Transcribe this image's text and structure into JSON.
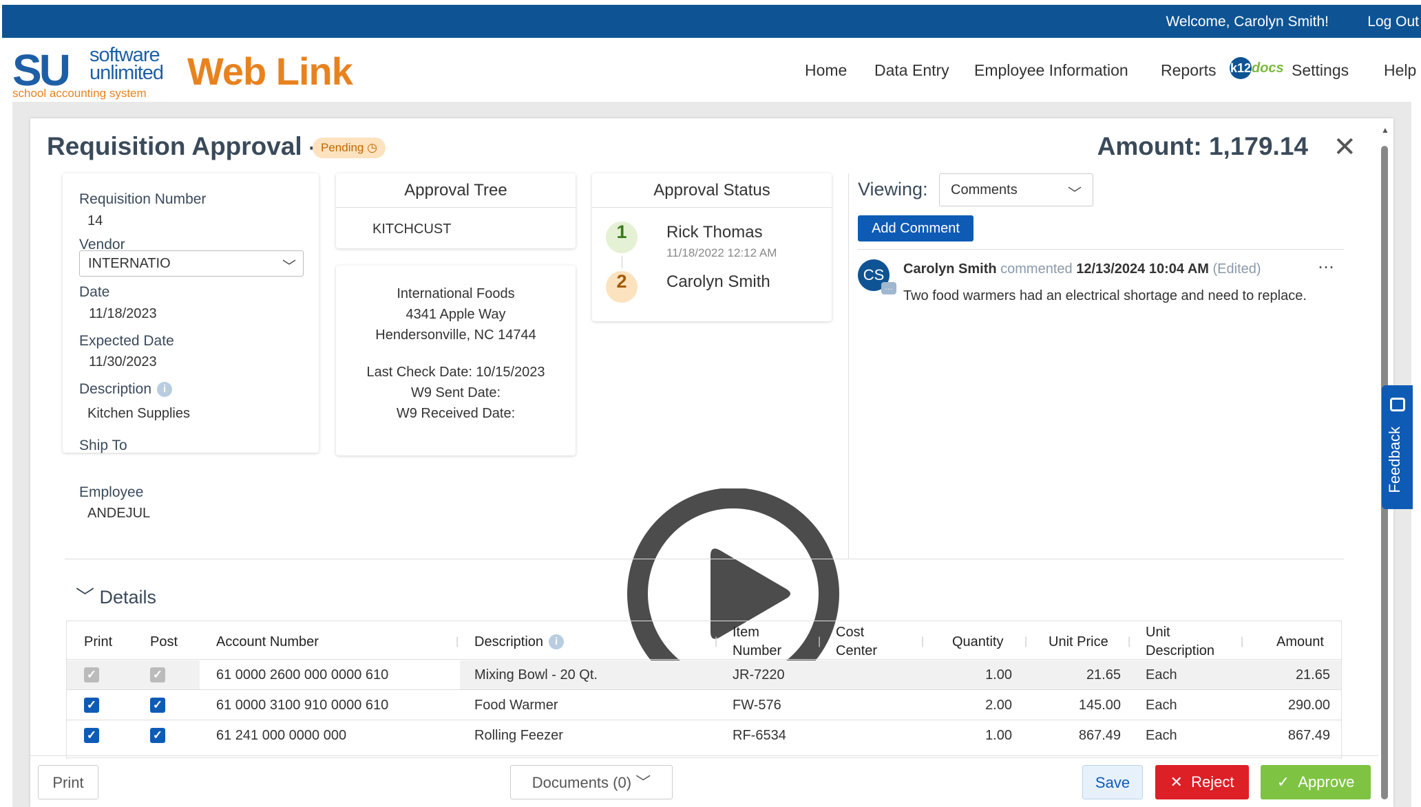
{
  "topbar": {
    "welcome": "Welcome, Carolyn Smith!",
    "logout": "Log Out"
  },
  "logo": {
    "su": "SU",
    "software": "software",
    "unlimited": "unlimited",
    "tagline": "school accounting system",
    "weblink": "Web Link"
  },
  "nav": {
    "home": "Home",
    "data_entry": "Data Entry",
    "employee": "Employee Information",
    "reports": "Reports",
    "k12": "k12",
    "docs": "docs",
    "settings": "Settings",
    "help": "Help"
  },
  "modal": {
    "title": "Requisition Approval -",
    "status": "Pending",
    "amount": "Amount: 1,179.14"
  },
  "info": {
    "req_label": "Requisition Number",
    "req_value": "14",
    "vendor_label": "Vendor",
    "vendor_value": "INTERNATIO",
    "date_label": "Date",
    "date_value": "11/18/2023",
    "expected_label": "Expected Date",
    "expected_value": "11/30/2023",
    "desc_label": "Description",
    "desc_value": "Kitchen Supplies",
    "ship_label": "Ship To",
    "employee_label": "Employee",
    "employee_value": "ANDEJUL"
  },
  "tree": {
    "title": "Approval Tree",
    "value": "KITCHCUST"
  },
  "vendor_card": {
    "name": "International Foods",
    "street": "4341 Apple Way",
    "city": "Hendersonville, NC 14744",
    "last_check": "Last Check Date: 10/15/2023",
    "w9_sent": "W9 Sent Date:",
    "w9_received": "W9 Received Date:"
  },
  "status": {
    "title": "Approval Status",
    "steps": [
      {
        "num": "1",
        "name": "Rick Thomas",
        "time": "11/18/2022 12:12 AM"
      },
      {
        "num": "2",
        "name": "Carolyn Smith"
      }
    ]
  },
  "comments": {
    "viewing_label": "Viewing:",
    "viewing_value": "Comments",
    "add_label": "Add Comment",
    "item": {
      "initials": "CS",
      "author": "Carolyn Smith",
      "action": "commented",
      "time": "12/13/2024 10:04 AM",
      "edited": "(Edited)",
      "text": "Two food warmers had an electrical shortage and need to replace."
    }
  },
  "details": {
    "label": "Details",
    "headers": {
      "print": "Print",
      "post": "Post",
      "account": "Account Number",
      "description": "Description",
      "item1": "Item",
      "item2": "Number",
      "cost1": "Cost",
      "cost2": "Center",
      "quantity": "Quantity",
      "unit_price": "Unit Price",
      "unit1": "Unit",
      "unit2": "Description",
      "amount": "Amount"
    },
    "rows": [
      {
        "account": "61 0000 2600 000 0000 610",
        "description": "Mixing Bowl - 20 Qt.",
        "item": "JR-7220",
        "quantity": "1.00",
        "unit_price": "21.65",
        "unit": "Each",
        "amount": "21.65"
      },
      {
        "account": "61 0000 3100 910 0000 610",
        "description": "Food Warmer",
        "item": "FW-576",
        "quantity": "2.00",
        "unit_price": "145.00",
        "unit": "Each",
        "amount": "290.00"
      },
      {
        "account": "61 241 000 0000 000",
        "description": "Rolling Feezer",
        "item": "RF-6534",
        "quantity": "1.00",
        "unit_price": "867.49",
        "unit": "Each",
        "amount": "867.49"
      }
    ]
  },
  "footer": {
    "print": "Print",
    "documents": "Documents (0)",
    "save": "Save",
    "reject": "Reject",
    "approve": "Approve"
  },
  "feedback": "Feedback",
  "colors": {
    "brand": "#0e5494",
    "orange": "#e8821f",
    "reject": "#dd1f26",
    "approve": "#7ec442"
  }
}
